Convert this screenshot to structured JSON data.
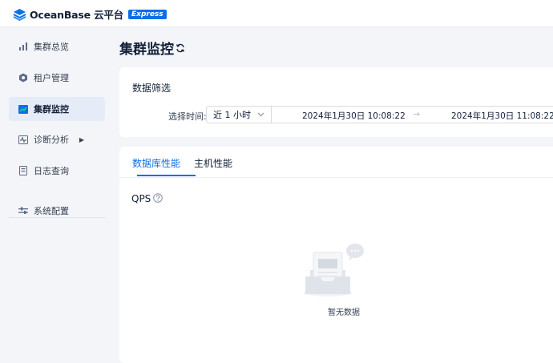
{
  "brand": {
    "name": "OceanBase 云平台",
    "badge": "Express"
  },
  "sidebar": {
    "items": [
      {
        "label": "集群总览",
        "icon": "bar-chart-icon"
      },
      {
        "label": "租户管理",
        "icon": "tenant-icon"
      },
      {
        "label": "集群监控",
        "icon": "monitor-icon",
        "active": true
      },
      {
        "label": "诊断分析",
        "icon": "diagnosis-icon",
        "has_submenu": true
      },
      {
        "label": "日志查询",
        "icon": "log-icon"
      },
      {
        "label": "系统配置",
        "icon": "settings-icon"
      }
    ]
  },
  "page": {
    "title": "集群监控"
  },
  "filter": {
    "title": "数据筛选",
    "time_label": "选择时间:",
    "time_select": "近 1 小时",
    "range_start": "2024年1月30日 10:08:22",
    "range_separator": "→",
    "range_end": "2024年1月30日 11:08:22"
  },
  "tabs": [
    {
      "label": "数据库性能",
      "active": true
    },
    {
      "label": "主机性能",
      "active": false
    }
  ],
  "metric": {
    "name": "QPS",
    "empty_text": "暂无数据"
  },
  "colors": {
    "accent": "#0d6fe6",
    "background": "#f3f5f9",
    "active_nav": "#e5ecf8"
  }
}
